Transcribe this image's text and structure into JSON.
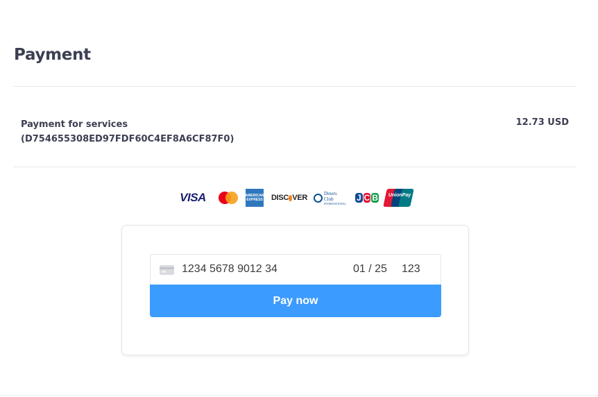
{
  "page": {
    "title": "Payment"
  },
  "summary": {
    "label_line1": "Payment for services",
    "label_line2": "(D754655308ED97FDF60C4EF8A6CF87F0)",
    "amount": "12.73 USD"
  },
  "brands": {
    "visa": "VISA",
    "amex_line1": "AMERICAN",
    "amex_line2": "EXPRESS",
    "discover_a": "DISC",
    "discover_b": "VER",
    "diners_line1": "Diners Club",
    "diners_line2": "INTERNATIONAL",
    "jcb": [
      "J",
      "C",
      "B"
    ],
    "unionpay": "UnionPay",
    "icons": [
      "visa-logo",
      "mastercard-logo",
      "amex-logo",
      "discover-logo",
      "diners-club-logo",
      "jcb-logo",
      "unionpay-logo"
    ]
  },
  "card_form": {
    "number": "1234 5678 9012 34",
    "expiry": "01 / 25",
    "cvc": "123",
    "card_icon": "credit-card-icon"
  },
  "pay_button": {
    "label": "Pay now",
    "color": "#3c9bff"
  }
}
